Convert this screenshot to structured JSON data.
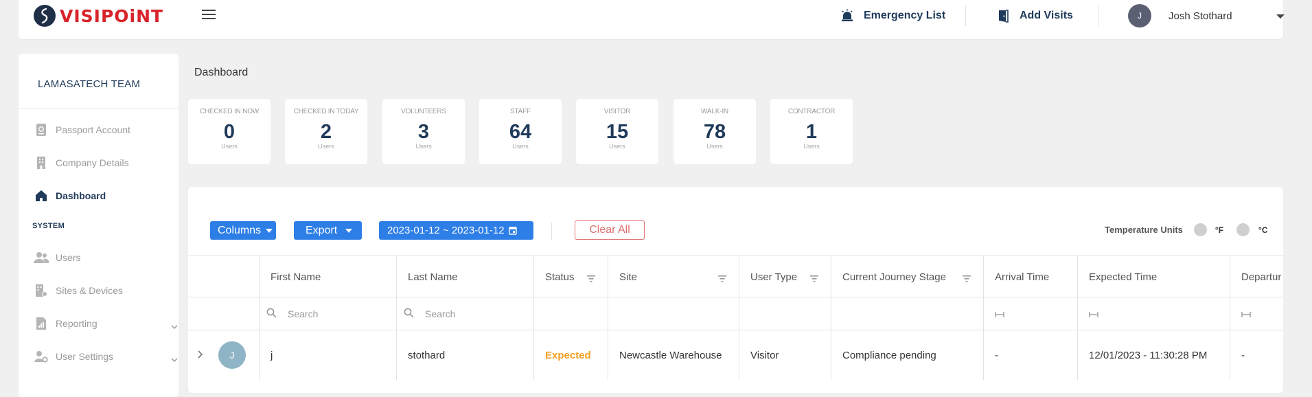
{
  "brand": {
    "name": "VISIPOiNT"
  },
  "topnav": {
    "emergency_label": "Emergency List",
    "add_visits_label": "Add Visits"
  },
  "user": {
    "name": "Josh Stothard",
    "initial": "J"
  },
  "sidebar": {
    "team": "LAMASATECH TEAM",
    "items": [
      {
        "label": "Passport Account"
      },
      {
        "label": "Company Details"
      },
      {
        "label": "Dashboard"
      }
    ],
    "section": "SYSTEM",
    "system_items": [
      {
        "label": "Users"
      },
      {
        "label": "Sites & Devices"
      },
      {
        "label": "Reporting"
      },
      {
        "label": "User Settings"
      }
    ]
  },
  "breadcrumb": "Dashboard",
  "stats": [
    {
      "label": "CHECKED IN NOW",
      "value": "0",
      "unit": "Users"
    },
    {
      "label": "CHECKED IN TODAY",
      "value": "2",
      "unit": "Users"
    },
    {
      "label": "VOLUNTEERS",
      "value": "3",
      "unit": "Users"
    },
    {
      "label": "STAFF",
      "value": "64",
      "unit": "Users"
    },
    {
      "label": "VISITOR",
      "value": "15",
      "unit": "Users"
    },
    {
      "label": "WALK-IN",
      "value": "78",
      "unit": "Users"
    },
    {
      "label": "CONTRACTOR",
      "value": "1",
      "unit": "Users"
    }
  ],
  "toolbar": {
    "columns_label": "Columns",
    "export_label": "Export",
    "date_range": "2023-01-12 ~ 2023-01-12",
    "clear_label": "Clear All",
    "temp_label": "Temperature Units",
    "unit_f": "°F",
    "unit_c": "°C"
  },
  "table": {
    "headers": [
      "First Name",
      "Last Name",
      "Status",
      "Site",
      "User Type",
      "Current Journey Stage",
      "Arrival Time",
      "Expected Time",
      "Departur"
    ],
    "search_placeholder": "Search",
    "rows": [
      {
        "avatar": "J",
        "first": "j",
        "last": "stothard",
        "status": "Expected",
        "site": "Newcastle Warehouse",
        "type": "Visitor",
        "stage": "Compliance pending",
        "arrival": "-",
        "expected": "12/01/2023 - 11:30:28 PM",
        "departure": "-"
      }
    ]
  },
  "colors": {
    "accent": "#2d7ee6",
    "navy": "#1f3a5a",
    "brand_red": "#d8232a",
    "status_expected": "#f0a020",
    "clear": "#e06e6e"
  }
}
